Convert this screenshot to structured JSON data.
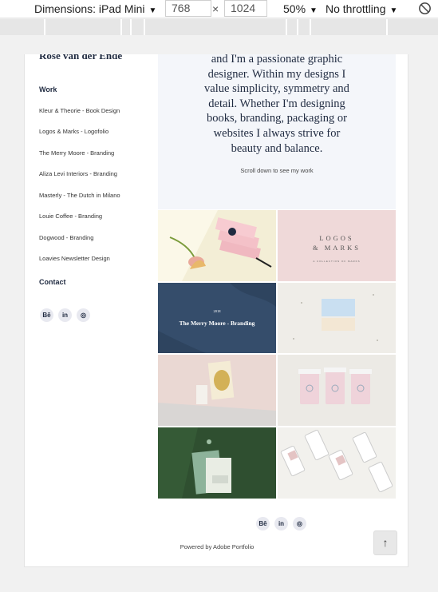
{
  "devtools": {
    "dimensions_label": "Dimensions: iPad Mini",
    "width_value": "768",
    "times_sign": "×",
    "height_value": "1024",
    "zoom_label": "50%",
    "throttling_label": "No throttling",
    "caret": "▼"
  },
  "sidebar": {
    "site_title": "Rose van der Ende",
    "work_heading": "Work",
    "items": [
      "Kleur & Theorie - Book Design",
      "Logos & Marks - Logofolio",
      "The Merry Moore - Branding",
      "Aliza Levi Interiors - Branding",
      "Masterly - The Dutch in Milano",
      "Louie Coffee - Branding",
      "Dogwood - Branding",
      "Loavies Newsletter Design"
    ],
    "contact_heading": "Contact"
  },
  "social": {
    "behance": "Bē",
    "linkedin": "in",
    "instagram": "◎"
  },
  "hero": {
    "lines": [
      "and I'm a passionate graphic",
      "designer. Within my designs I",
      "value simplicity, symmetry and",
      "detail. Whether I'm designing",
      "books, branding, packaging or",
      "websites I always strive for",
      "beauty and balance."
    ],
    "scroll_hint": "Scroll down to see my work"
  },
  "tiles": {
    "logos_title_1": "LOGOS",
    "logos_title_2": "& MARKS",
    "logos_sub": "A COLLECTION OF MARKS",
    "merry_year": "2018",
    "merry_title": "The Merry Moore - Branding"
  },
  "footer": {
    "powered": "Powered by Adobe Portfolio",
    "top_arrow": "↑"
  },
  "colors": {
    "navy": "#1f2a40",
    "hero_bg": "#f4f6fa",
    "merry_bg": "#354d6b",
    "logos_bg": "#efd9d9",
    "dogwood_bg": "#2f4f30"
  }
}
